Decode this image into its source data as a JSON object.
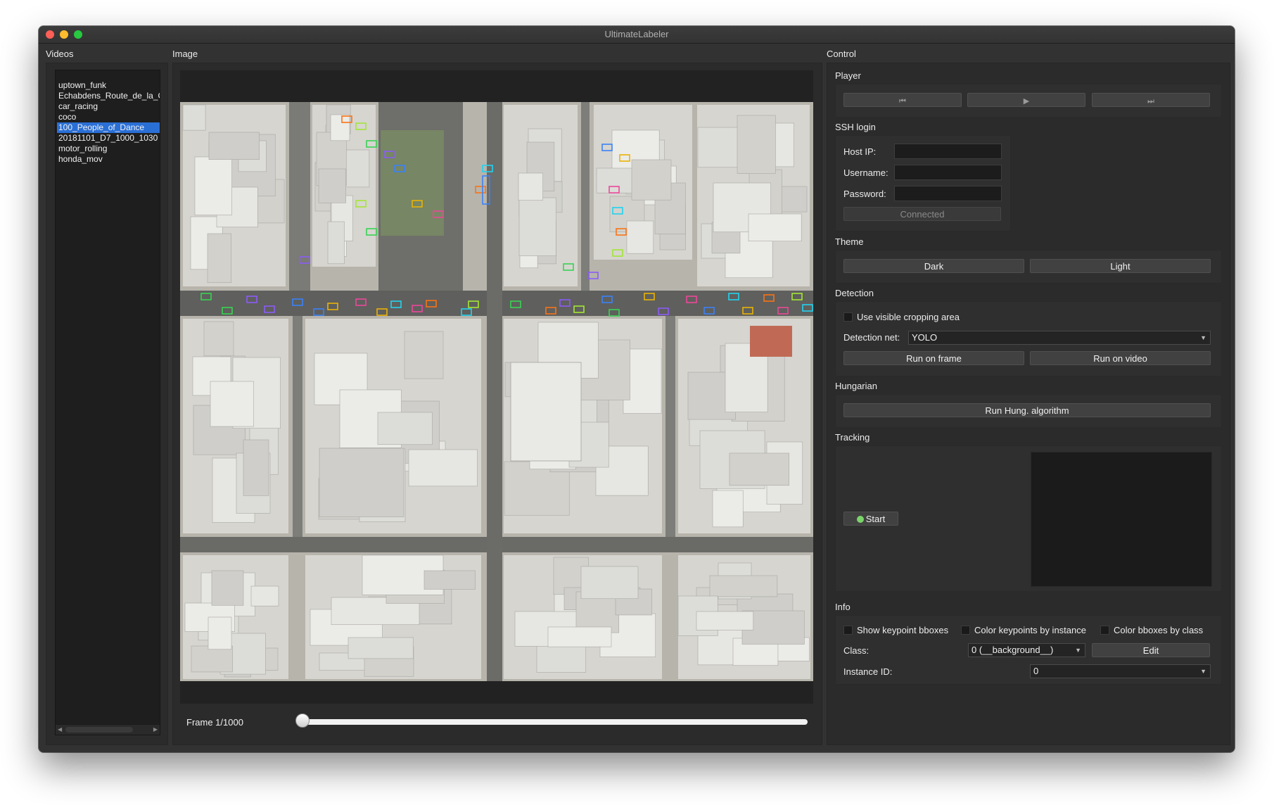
{
  "window": {
    "title": "UltimateLabeler"
  },
  "videos": {
    "title": "Videos",
    "items": [
      "uptown_funk",
      "Echabdens_Route_de_la_C",
      "car_racing",
      "coco",
      "100_People_of_Dance",
      "20181101_D7_1000_1030",
      "motor_rolling",
      "honda_mov"
    ],
    "selected_index": 4
  },
  "image": {
    "title": "Image",
    "frame_label": "Frame 1/1000",
    "frame_current": 1,
    "frame_total": 1000
  },
  "control": {
    "title": "Control",
    "player": {
      "title": "Player",
      "prev_icon": "skip-back-icon",
      "play_icon": "play-icon",
      "next_icon": "skip-forward-icon"
    },
    "ssh": {
      "title": "SSH login",
      "host_label": "Host IP:",
      "username_label": "Username:",
      "password_label": "Password:",
      "host_value": "",
      "username_value": "",
      "password_value": "",
      "status_button": "Connected"
    },
    "theme": {
      "title": "Theme",
      "dark": "Dark",
      "light": "Light"
    },
    "detection": {
      "title": "Detection",
      "cropping_label": "Use visible cropping area",
      "net_label": "Detection net:",
      "net_value": "YOLO",
      "run_frame": "Run on frame",
      "run_video": "Run on video"
    },
    "hungarian": {
      "title": "Hungarian",
      "run": "Run Hung. algorithm"
    },
    "tracking": {
      "title": "Tracking",
      "start": "Start"
    },
    "info": {
      "title": "Info",
      "show_kp_bboxes": "Show keypoint bboxes",
      "color_kp_instance": "Color keypoints by instance",
      "color_bbox_class": "Color bboxes by class",
      "class_label": "Class:",
      "class_value": "0 (__background__)",
      "edit": "Edit",
      "instance_label": "Instance ID:",
      "instance_value": "0"
    }
  },
  "colors": {
    "window_bg": "#323232",
    "selection": "#2a6fd6",
    "button_bg": "#414141",
    "status_dot": "#7bd46a"
  }
}
